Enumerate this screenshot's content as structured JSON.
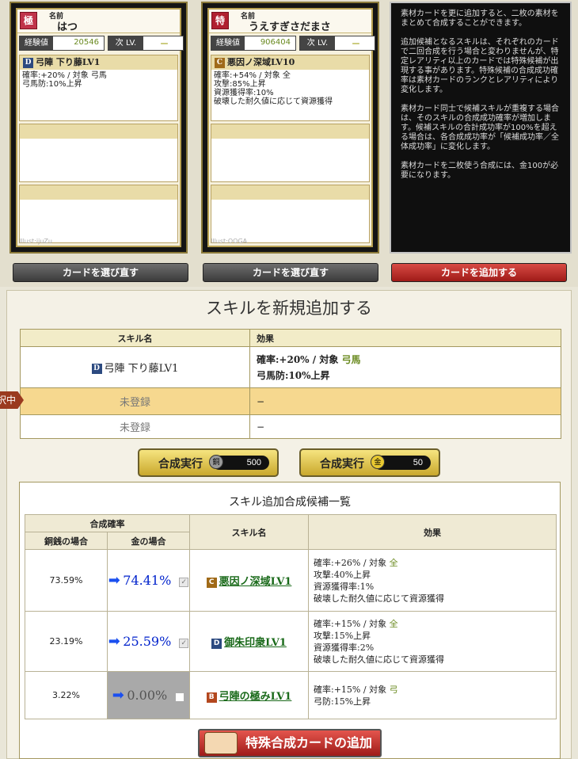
{
  "cards": [
    {
      "name_label": "名前",
      "name": "はつ",
      "rank": "極",
      "exp_label": "経験値",
      "exp": "20546",
      "next_label": "次 LV.",
      "next": "ー",
      "skill1": {
        "rank": "D",
        "title": "弓陣 下り藤LV1",
        "desc": "確率:+20% / 対象 弓馬\n弓馬防:10%上昇"
      },
      "illust": "Illust:ijuZu"
    },
    {
      "name_label": "名前",
      "name": "うえすぎさだまさ",
      "rank": "特",
      "exp_label": "経験値",
      "exp": "906404",
      "next_label": "次 LV.",
      "next": "ー",
      "skill1": {
        "rank": "C",
        "title": "悪因ノ深域LV10",
        "desc": "確率:+54% / 対象 全\n攻撃:85%上昇\n資源獲得率:10%\n破壊した耐久値に応じて資源獲得"
      },
      "illust": "Illust:OOGA"
    }
  ],
  "info": [
    "素材カードを更に追加すると、二枚の素材をまとめて合成することができます。",
    "追加候補となるスキルは、それぞれのカードで二回合成を行う場合と変わりませんが、特定レアリティ以上のカードでは特殊候補が出現する事があります。特殊候補の合成成功確率は素材カードのランクとレアリティにより変化します。",
    "素材カード同士で候補スキルが重複する場合は、そのスキルの合成成功確率が増加します。候補スキルの合計成功率が100%を超える場合は、各合成成功率が「候補成功率／全体成功率」に変化します。",
    "素材カードを二枚使う合成には、金100が必要になります。"
  ],
  "buttons": {
    "reselect1": "カードを選び直す",
    "reselect2": "カードを選び直す",
    "add_card": "カードを追加する"
  },
  "section_title": "スキルを新規追加する",
  "skill_table": {
    "headers": [
      "スキル名",
      "効果"
    ],
    "rows": [
      {
        "rank": "D",
        "name": "弓陣 下り藤LV1",
        "effect_l1": "確率:+20% / 対象",
        "target": "弓馬",
        "effect_l2": "弓馬防:10%上昇"
      },
      {
        "name": "未登録",
        "effect": "−"
      },
      {
        "name": "未登録",
        "effect": "−"
      }
    ],
    "marker": "択中"
  },
  "exec_buttons": [
    {
      "label": "合成実行",
      "coin": "銅",
      "cost": "500"
    },
    {
      "label": "合成実行",
      "coin": "金",
      "cost": "50"
    }
  ],
  "candidates": {
    "title": "スキル追加合成候補一覧",
    "headers": {
      "prob": "合成確率",
      "copper": "銅銭の場合",
      "gold": "金の場合",
      "name": "スキル名",
      "effect": "効果"
    },
    "rows": [
      {
        "copper": "73.59%",
        "gold": "74.41%",
        "rank": "C",
        "name": "悪因ノ深域LV1",
        "effects": [
          "確率:+26% / 対象 ",
          "攻撃:40%上昇",
          "資源獲得率:1%",
          "破壊した耐久値に応じて資源獲得"
        ],
        "target": "全"
      },
      {
        "copper": "23.19%",
        "gold": "25.59%",
        "rank": "D",
        "name": "御朱印衆LV1",
        "effects": [
          "確率:+15% / 対象 ",
          "攻撃:15%上昇",
          "資源獲得率:2%",
          "破壊した耐久値に応じて資源獲得"
        ],
        "target": "全"
      },
      {
        "copper": "3.22%",
        "gold": "0.00%",
        "rank": "B",
        "name": "弓陣の極みLV1",
        "effects": [
          "確率:+15% / 対象 ",
          "弓防:15%上昇"
        ],
        "target": "弓"
      }
    ]
  },
  "special_button": "特殊合成カードの追加"
}
